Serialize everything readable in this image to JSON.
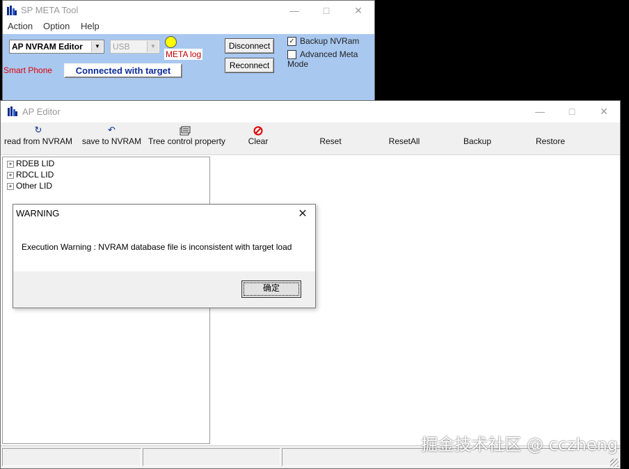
{
  "meta_window": {
    "title": "SP META Tool",
    "menu": [
      "Action",
      "Option",
      "Help"
    ],
    "mode_combo": "AP NVRAM Editor",
    "conn_combo": "USB",
    "meta_log_label": "META log",
    "smart_phone_label": "Smart Phone",
    "status_text": "Connected with target",
    "disconnect_label": "Disconnect",
    "reconnect_label": "Reconnect",
    "backup_nvram": {
      "label": "Backup NVRam",
      "checked": true
    },
    "advanced_meta_mode": {
      "label": "Advanced Meta Mode",
      "checked": false
    },
    "colors": {
      "panel_bg": "#a8c8f0",
      "led": "#ffff00",
      "status_text": "#0a2a9a",
      "red_text": "#e00000"
    }
  },
  "ap_window": {
    "title": "AP Editor",
    "toolbar": [
      {
        "label": "read from NVRAM",
        "icon": "read-icon"
      },
      {
        "label": "save to NVRAM",
        "icon": "save-icon"
      },
      {
        "label": "Tree control property",
        "icon": "property-icon"
      },
      {
        "label": "Clear",
        "icon": "clear-icon"
      },
      {
        "label": "Reset",
        "icon": ""
      },
      {
        "label": "ResetAll",
        "icon": ""
      },
      {
        "label": "Backup",
        "icon": ""
      },
      {
        "label": "Restore",
        "icon": ""
      }
    ],
    "tree": [
      "RDEB LID",
      "RDCL LID",
      "Other LID"
    ]
  },
  "dialog": {
    "title": "WARNING",
    "message": "Execution Warning : NVRAM database file is inconsistent with target load",
    "ok_label": "确定"
  },
  "watermark": "掘金技术社区 @ cczheng"
}
